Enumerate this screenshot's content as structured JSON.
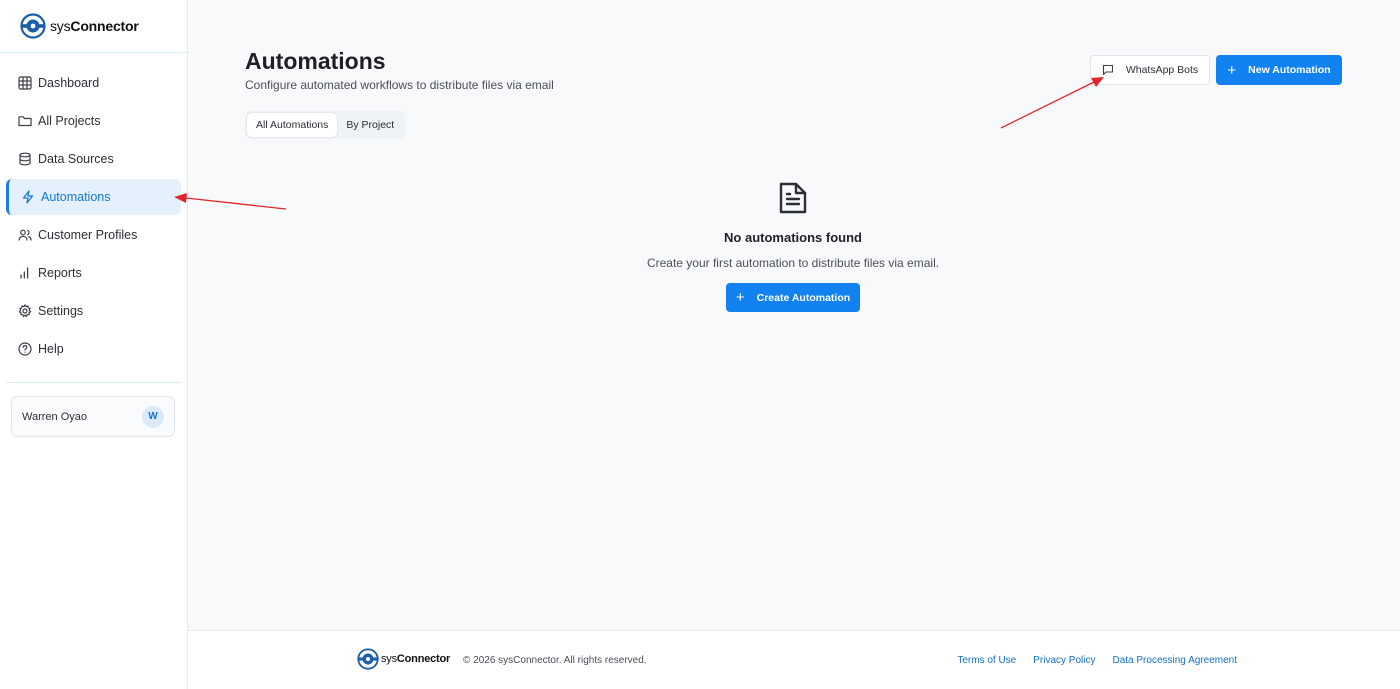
{
  "brand": {
    "prefix": "sys",
    "name": "Connector"
  },
  "sidebar": {
    "items": [
      {
        "label": "Dashboard",
        "icon": "grid-icon"
      },
      {
        "label": "All Projects",
        "icon": "folder-icon"
      },
      {
        "label": "Data Sources",
        "icon": "database-icon"
      },
      {
        "label": "Automations",
        "icon": "lightning-icon",
        "active": true
      },
      {
        "label": "Customer Profiles",
        "icon": "users-icon"
      },
      {
        "label": "Reports",
        "icon": "bar-chart-icon"
      },
      {
        "label": "Settings",
        "icon": "gear-icon"
      },
      {
        "label": "Help",
        "icon": "help-circle-icon"
      }
    ],
    "user": {
      "name": "Warren Oyao",
      "initial": "W"
    }
  },
  "header": {
    "title": "Automations",
    "subtitle": "Configure automated workflows to distribute files via email",
    "whatsapp_label": "WhatsApp Bots",
    "new_label": "New Automation"
  },
  "tabs": [
    {
      "label": "All Automations",
      "active": true
    },
    {
      "label": "By Project",
      "active": false
    }
  ],
  "empty_state": {
    "title": "No automations found",
    "text": "Create your first automation to distribute files via email.",
    "button_label": "Create Automation",
    "icon": "document-icon"
  },
  "footer": {
    "copyright": "© 2026 sysConnector. All rights reserved.",
    "links": [
      "Terms of Use",
      "Privacy Policy",
      "Data Processing Agreement"
    ]
  },
  "colors": {
    "accent": "#1182f0",
    "active_bg": "#e4f1fc",
    "annotation_arrow": "#e0262b"
  }
}
